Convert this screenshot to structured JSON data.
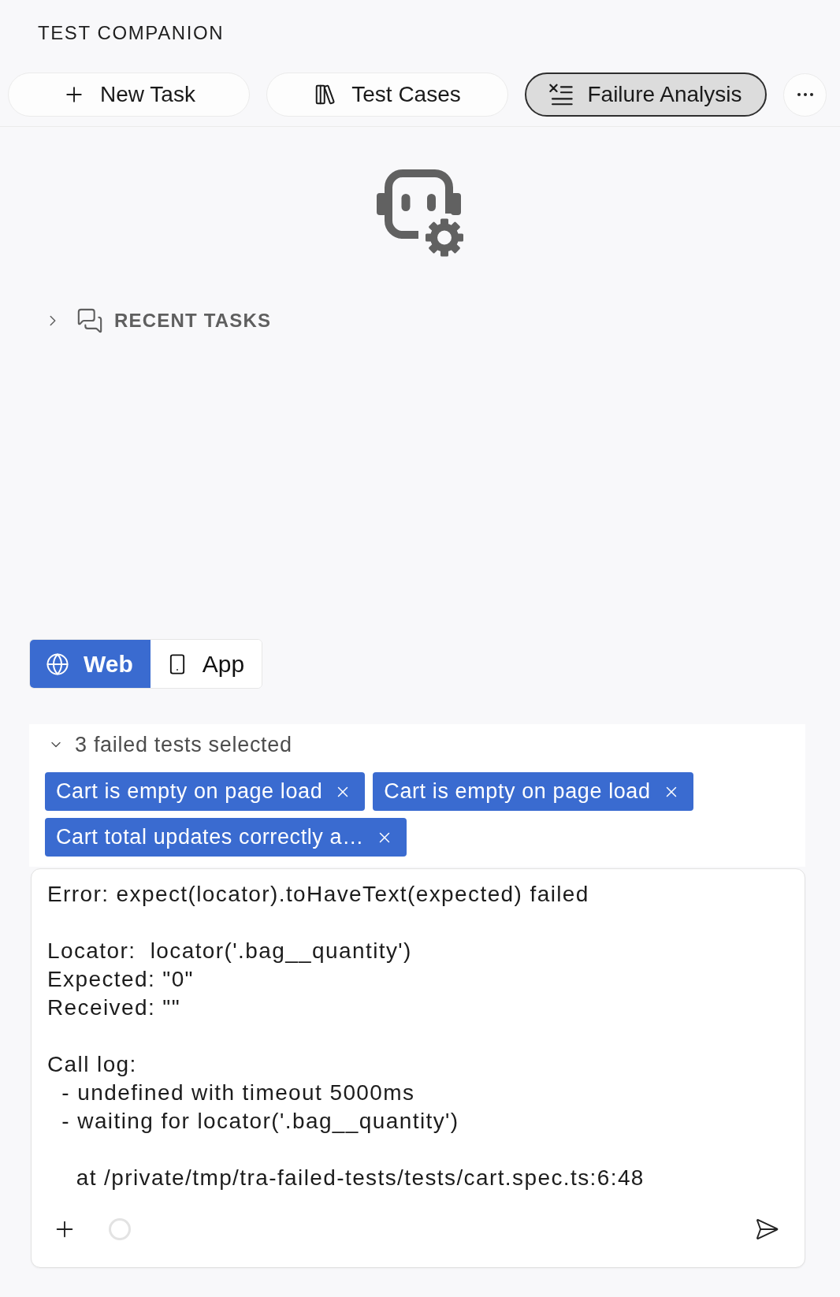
{
  "header": {
    "title": "TEST COMPANION"
  },
  "tabs": [
    {
      "label": "New Task",
      "selected": false
    },
    {
      "label": "Test Cases",
      "selected": false
    },
    {
      "label": "Failure Analysis",
      "selected": true
    }
  ],
  "recent_tasks": {
    "label": "RECENT TASKS",
    "expanded": false
  },
  "platform_toggle": [
    {
      "label": "Web",
      "selected": true
    },
    {
      "label": "App",
      "selected": false
    }
  ],
  "failed_tests": {
    "summary": "3 failed tests selected",
    "expanded": true,
    "chips": [
      {
        "label": "Cart is empty on page load"
      },
      {
        "label": "Cart is empty on page load"
      },
      {
        "label": "Cart total updates correctly a…"
      }
    ]
  },
  "composer": {
    "value": "Error: expect(locator).toHaveText(expected) failed\n\nLocator:  locator('.bag__quantity')\nExpected: \"0\"\nReceived: \"\"\n\nCall log:\n  - undefined with timeout 5000ms\n  - waiting for locator('.bag__quantity')\n\n    at /private/tmp/tra-failed-tests/tests/cart.spec.ts:6:48"
  }
}
